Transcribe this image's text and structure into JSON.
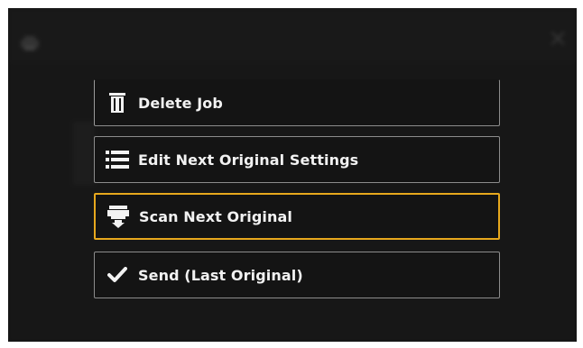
{
  "background": {
    "header_icon": "printer-icon",
    "close_icon": "close-icon"
  },
  "menu": {
    "items": [
      {
        "label": "Delete Job",
        "icon": "trash-icon",
        "focused": false
      },
      {
        "label": "Edit Next Original Settings",
        "icon": "list-icon",
        "focused": false
      },
      {
        "label": "Scan Next Original",
        "icon": "scanner-icon",
        "focused": true
      },
      {
        "label": "Send (Last Original)",
        "icon": "checkmark-icon",
        "focused": false
      }
    ]
  },
  "colors": {
    "focus_border": "#e7a81d",
    "item_border": "#8c8c8c",
    "text": "#f2f2f2"
  }
}
